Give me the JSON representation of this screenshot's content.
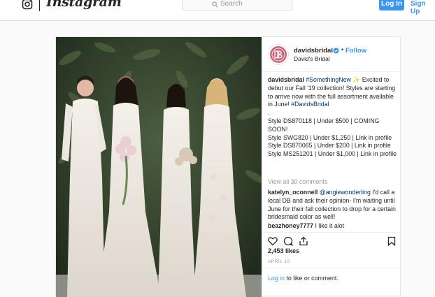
{
  "app": {
    "wordmark": "Instagram"
  },
  "topbar": {
    "search_placeholder": "Search",
    "login_label": "Log In",
    "signup_label": "Sign Up"
  },
  "post": {
    "username": "davidsbridal",
    "follow_label": "Follow",
    "full_name": "David's Bridal",
    "caption": {
      "user": "davidsbridal",
      "hashtag1": "#SomethingNew",
      "emoji": "✨",
      "text1": " Excited to debut our Fall '19 collection! Styles are starting to arrive now with the full assortment available in June! ",
      "hashtag2": "#DavidsBridal",
      "dot": ".",
      "line1": "Style DS870118 | Under $500 | COMING SOON!",
      "line2": "Style SWG820 | Under $1,250 | Link in profile",
      "line3": "Style DS870065 | Under $200 | Link in profile",
      "line4": "Style MS251201 | Under $1,000 | Link in profile"
    },
    "view_all": "View all 30 comments",
    "comments": [
      {
        "user": "katelyn_oconnell",
        "mention": "@angiewonderling",
        "text": " I'd call a local DB and ask their opinion- I'm waiting until June for their fall collection to drop for a certain bridesmaid color as well!"
      },
      {
        "user": "beazhoney7777",
        "text": " I like it alot"
      }
    ],
    "likes": "2,453 likes",
    "date": "APRIL 10",
    "login_prompt": {
      "link": "Log in",
      "text": " to like or comment."
    }
  },
  "colors": {
    "accent": "#3897f0",
    "brand_pink": "#c8687a",
    "text": "#262626",
    "muted": "#999999"
  },
  "icons": [
    "instagram-glyph-icon",
    "search-icon",
    "verified-badge-icon",
    "heart-icon",
    "comment-icon",
    "share-icon",
    "bookmark-icon"
  ]
}
